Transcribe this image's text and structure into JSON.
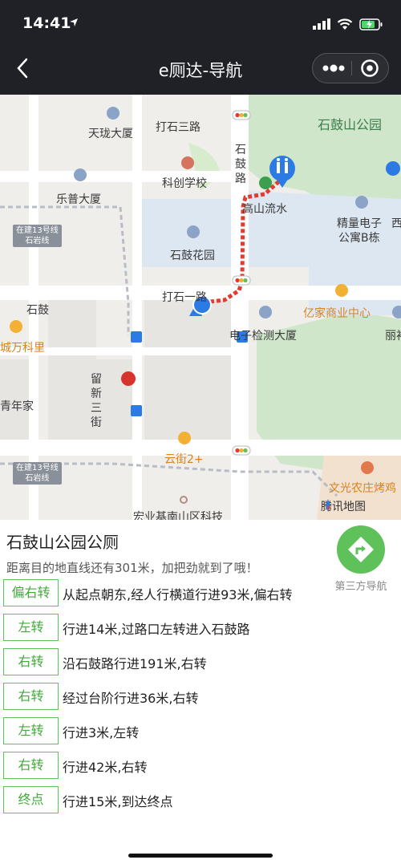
{
  "status_bar": {
    "time": "14:41"
  },
  "nav": {
    "title": "e厕达-导航"
  },
  "map": {
    "labels": {
      "tianlong": "天珑大厦",
      "dashisanlu": "打石三路",
      "shigu_road": "石鼓路",
      "shigushan_park": "石鼓山公园",
      "kechuang_school": "科创学校",
      "lepu": "乐普大厦",
      "gaoshan": "高山流水",
      "jingliang": "精量电子",
      "gongyu_b": "公寓B栋",
      "xi": "西",
      "metro1": "在建13号线",
      "metro1b": "石岩线",
      "shigu_garden": "石鼓花园",
      "dashiyilu": "打石一路",
      "shigu": "石鼓",
      "yijia": "亿家商业中心",
      "wanke": "城万科里",
      "dianzi": "电子检测大厦",
      "li": "丽衫",
      "liuxin": "留新三街",
      "qingnian": "青年家",
      "yunjie": "云街2+",
      "metro2": "在建13号线",
      "metro2b": "石岩线",
      "wenguang": "文光农庄烤鸡",
      "hongyuan": "宏业基南山区科技"
    },
    "attribution": "腾讯地图",
    "route_color": "#e23b32",
    "location_color": "#2c7be5"
  },
  "destination": {
    "title": "石鼓山公园公厕",
    "subtitle": "距离目的地直线还有301米，加把劲就到了哦！"
  },
  "third_party_nav": {
    "label": "第三方导航",
    "color": "#5fc15a"
  },
  "steps": [
    {
      "badge": "偏右转",
      "text": "从起点朝东,经人行横道行进93米,偏右转"
    },
    {
      "badge": "左转",
      "text": "行进14米,过路口左转进入石鼓路"
    },
    {
      "badge": "右转",
      "text": "沿石鼓路行进191米,右转"
    },
    {
      "badge": "右转",
      "text": "经过台阶行进36米,右转"
    },
    {
      "badge": "左转",
      "text": "行进3米,左转"
    },
    {
      "badge": "右转",
      "text": "行进42米,右转"
    },
    {
      "badge": "终点",
      "text": "行进15米,到达终点"
    }
  ]
}
